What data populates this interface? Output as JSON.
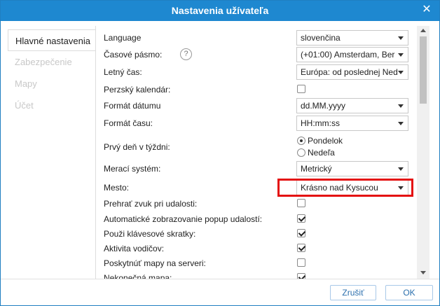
{
  "window": {
    "title": "Nastavenia užívateľa"
  },
  "sidebar": {
    "items": [
      {
        "label": "Hlavné nastavenia"
      },
      {
        "label": "Zabezpečenie"
      },
      {
        "label": "Mapy"
      },
      {
        "label": "Účet"
      }
    ]
  },
  "form": {
    "language": {
      "label": "Language",
      "value": "slovenčina"
    },
    "timezone": {
      "label": "Časové pásmo:",
      "value": "(+01:00) Amsterdam, Ber",
      "help": "?"
    },
    "dst": {
      "label": "Letný čas:",
      "value": "Európa: od poslednej Ned"
    },
    "persian_calendar": {
      "label": "Perzský kalendár:",
      "checked": false
    },
    "date_format": {
      "label": "Formát dátumu",
      "value": "dd.MM.yyyy"
    },
    "time_format": {
      "label": "Formát času:",
      "value": "HH:mm:ss"
    },
    "first_day": {
      "label": "Prvý deň v týždni:",
      "options": [
        "Pondelok",
        "Nedeľa"
      ],
      "selected": "Pondelok"
    },
    "units": {
      "label": "Merací systém:",
      "value": "Metrický"
    },
    "city": {
      "label": "Mesto:",
      "value": "Krásno nad Kysucou"
    },
    "sound_on_event": {
      "label": "Prehrať zvuk pri udalosti:",
      "checked": false
    },
    "auto_popup": {
      "label": "Automatické zobrazovanie popup udalostí:",
      "checked": true
    },
    "shortcuts": {
      "label": "Použi klávesové skratky:",
      "checked": true
    },
    "driver_activity": {
      "label": "Aktivita vodičov:",
      "checked": true
    },
    "server_map": {
      "label": "Poskytnúť mapy na serveri:",
      "checked": false
    },
    "last_row": {
      "label": "Nekonečná mapa:",
      "checked": true
    }
  },
  "footer": {
    "cancel_label": "Zrušiť",
    "ok_label": "OK"
  },
  "colors": {
    "titlebar": "#1e88d0",
    "highlight": "#e41010",
    "button_text": "#2b6fad"
  }
}
